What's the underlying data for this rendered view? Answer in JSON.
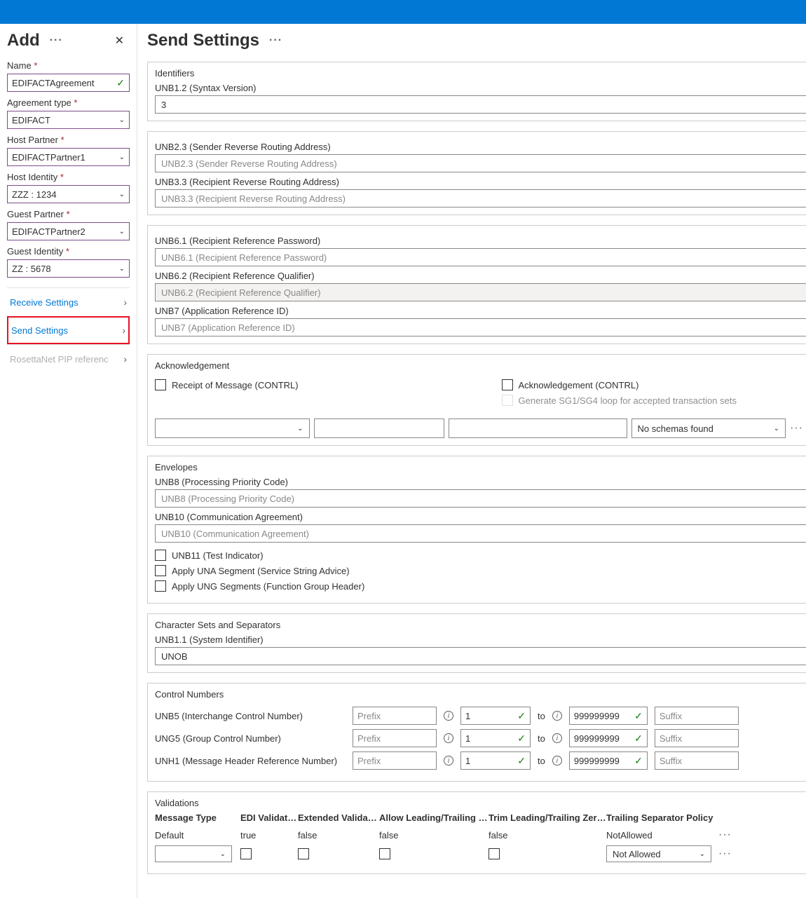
{
  "sidebar": {
    "title": "Add",
    "fields": {
      "name_label": "Name",
      "name_value": "EDIFACTAgreement",
      "type_label": "Agreement type",
      "type_value": "EDIFACT",
      "host_partner_label": "Host Partner",
      "host_partner_value": "EDIFACTPartner1",
      "host_identity_label": "Host Identity",
      "host_identity_value": "ZZZ : 1234",
      "guest_partner_label": "Guest Partner",
      "guest_partner_value": "EDIFACTPartner2",
      "guest_identity_label": "Guest Identity",
      "guest_identity_value": "ZZ : 5678"
    },
    "nav": {
      "receive": "Receive Settings",
      "send": "Send Settings",
      "rosetta": "RosettaNet PIP referenc"
    }
  },
  "main": {
    "title": "Send Settings",
    "identifiers": {
      "title": "Identifiers",
      "unb12_label": "UNB1.2 (Syntax Version)",
      "unb12_value": "3",
      "unb23_label": "UNB2.3 (Sender Reverse Routing Address)",
      "unb23_placeholder": "UNB2.3 (Sender Reverse Routing Address)",
      "unb33_label": "UNB3.3 (Recipient Reverse Routing Address)",
      "unb33_placeholder": "UNB3.3 (Recipient Reverse Routing Address)",
      "unb61_label": "UNB6.1 (Recipient Reference Password)",
      "unb61_placeholder": "UNB6.1 (Recipient Reference Password)",
      "unb62_label": "UNB6.2 (Recipient Reference Qualifier)",
      "unb62_placeholder": "UNB6.2 (Recipient Reference Qualifier)",
      "unb7_label": "UNB7 (Application Reference ID)",
      "unb7_placeholder": "UNB7 (Application Reference ID)"
    },
    "ack": {
      "title": "Acknowledgement",
      "receipt": "Receipt of Message (CONTRL)",
      "ack_contrl": "Acknowledgement (CONTRL)",
      "sg_loop": "Generate SG1/SG4 loop for accepted transaction sets",
      "no_schemas": "No schemas found"
    },
    "envelopes": {
      "title": "Envelopes",
      "unb8_label": "UNB8 (Processing Priority Code)",
      "unb8_placeholder": "UNB8 (Processing Priority Code)",
      "unb10_label": "UNB10 (Communication Agreement)",
      "unb10_placeholder": "UNB10 (Communication Agreement)",
      "unb11": "UNB11 (Test Indicator)",
      "una": "Apply UNA Segment (Service String Advice)",
      "ung": "Apply UNG Segments (Function Group Header)"
    },
    "charsets": {
      "title": "Character Sets and Separators",
      "unb11_label": "UNB1.1 (System Identifier)",
      "unb11_value": "UNOB"
    },
    "control": {
      "title": "Control Numbers",
      "unb5": "UNB5 (Interchange Control Number)",
      "ung5": "UNG5 (Group Control Number)",
      "unh1": "UNH1 (Message Header Reference Number)",
      "prefix": "Prefix",
      "suffix": "Suffix",
      "from": "1",
      "to_label": "to",
      "to_val": "999999999"
    },
    "validations": {
      "title": "Validations",
      "headers": {
        "msg_type": "Message Type",
        "edi": "EDI Validation",
        "ext": "Extended Validation",
        "lead": "Allow Leading/Trailing Zeros",
        "trim": "Trim Leading/Trailing Zeroes",
        "trail": "Trailing Separator Policy"
      },
      "row": {
        "msg_type": "Default",
        "edi": "true",
        "ext": "false",
        "lead": "false",
        "trim": "false",
        "trail": "NotAllowed"
      },
      "not_allowed": "Not Allowed"
    }
  }
}
